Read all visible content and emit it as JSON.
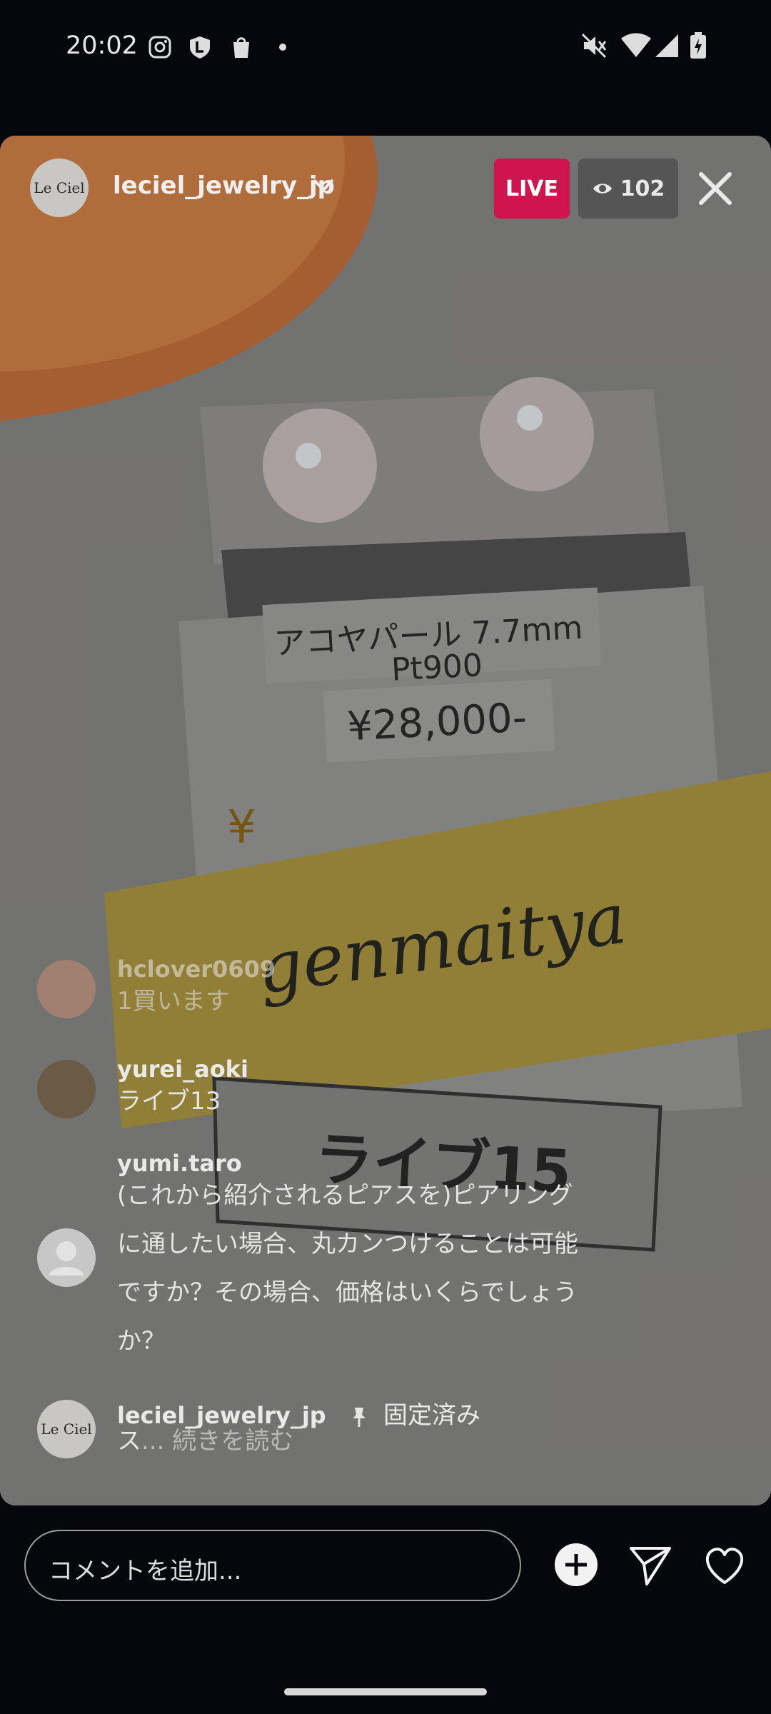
{
  "status_bar": {
    "time": "20:02"
  },
  "stream": {
    "host_avatar_text": "Le Ciel",
    "host_name": "leciel_jewelry_jp",
    "live_label": "LIVE",
    "viewer_count": "102"
  },
  "scene": {
    "card_line1": "アコヤパール 7.7mm",
    "card_line2": "Pt900",
    "card_price": "¥28,000-",
    "card_yen": "¥",
    "note_handwriting": "genmaitya",
    "tag_text": "ライブ15"
  },
  "comments": [
    {
      "user": "hclover0609",
      "text": "1買います"
    },
    {
      "user": "yurei_aoki",
      "text": "ライブ13"
    },
    {
      "user": "yumi.taro",
      "lines": [
        "(これから紹介されるピアスを)ピアリング",
        "に通したい場合、丸カンつけることは可能",
        "ですか？その場合、価格はいくらでしょう",
        "か？"
      ]
    },
    {
      "user": "leciel_jewelry_jp",
      "pinned_label": "固定済み",
      "text_prefix": "ス",
      "read_more": "... 続きを読む",
      "avatar_text": "Le Ciel"
    }
  ],
  "comment_input": {
    "placeholder": "コメントを追加..."
  }
}
